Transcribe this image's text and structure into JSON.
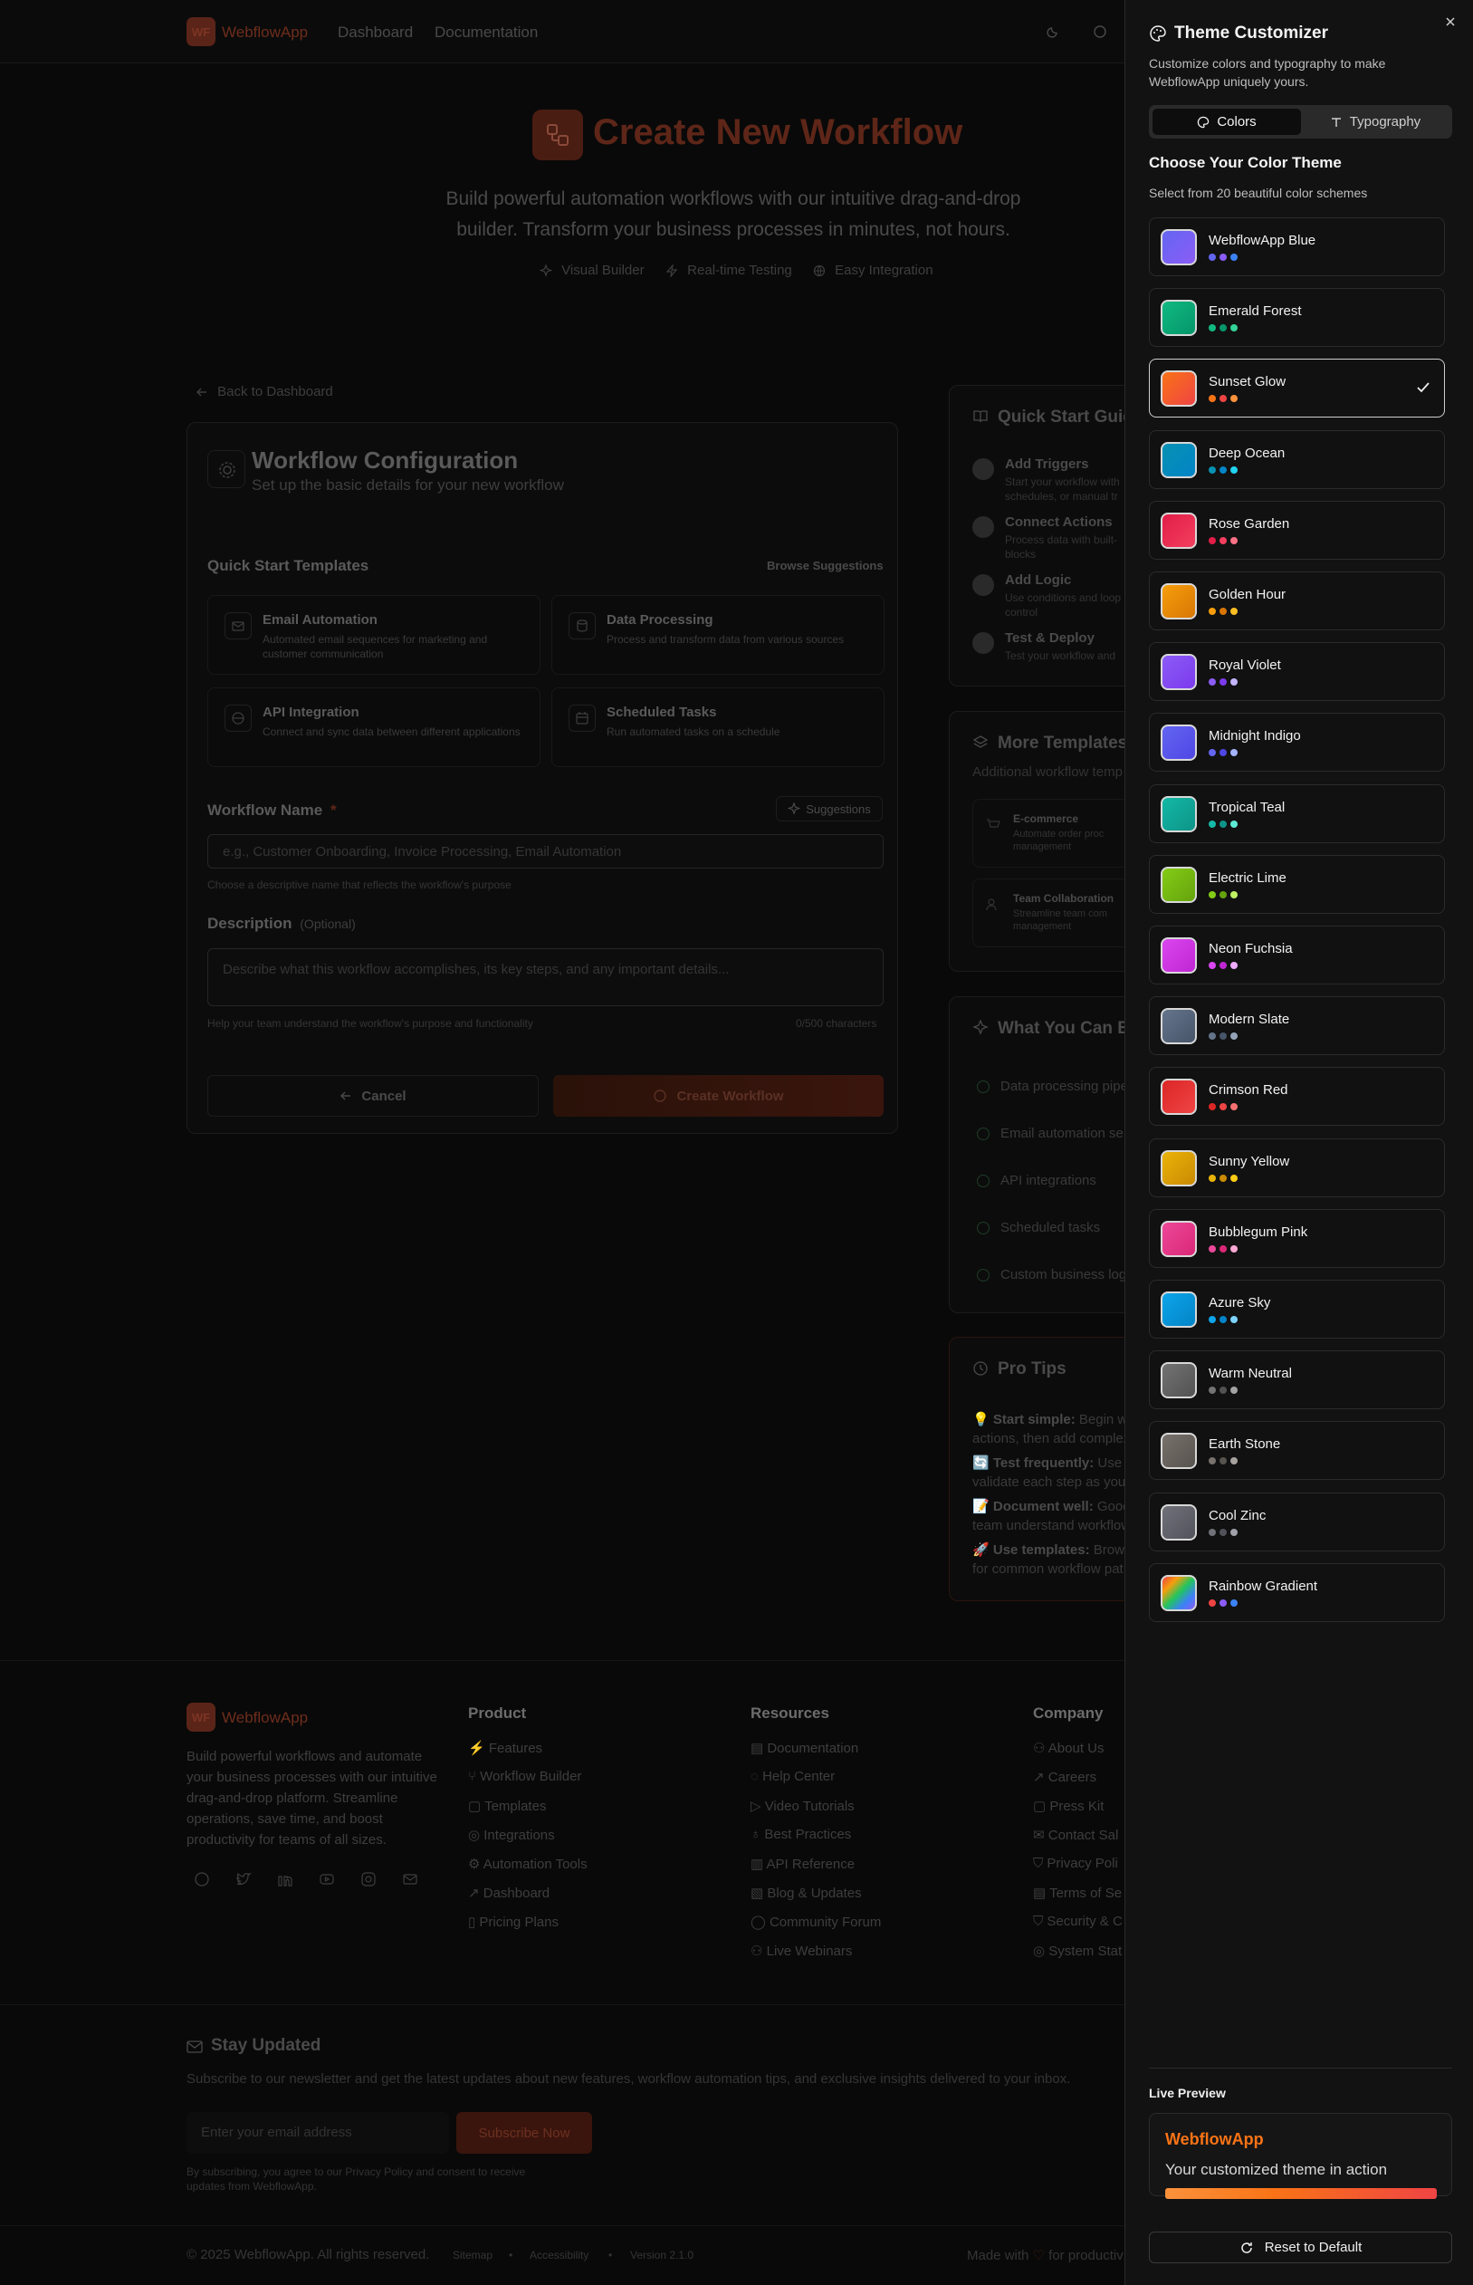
{
  "nav": {
    "logo_abbr": "WF",
    "brand": "WebflowApp",
    "links": [
      "Dashboard",
      "Documentation"
    ]
  },
  "hero": {
    "title": "Create New Workflow",
    "subtitle_line1": "Build powerful automation workflows with our intuitive drag-and-drop",
    "subtitle_line2": "builder. Transform your business processes in minutes, not hours.",
    "features": [
      "Visual Builder",
      "Real-time Testing",
      "Easy Integration"
    ]
  },
  "back_link": "Back to Dashboard",
  "config": {
    "title": "Workflow Configuration",
    "subtitle": "Set up the basic details for your new workflow",
    "templates_heading": "Quick Start Templates",
    "browse": "Browse Suggestions",
    "templates": [
      {
        "title": "Email Automation",
        "desc": "Automated email sequences for marketing and customer communication"
      },
      {
        "title": "Data Processing",
        "desc": "Process and transform data from various sources"
      },
      {
        "title": "API Integration",
        "desc": "Connect and sync data between different applications"
      },
      {
        "title": "Scheduled Tasks",
        "desc": "Run automated tasks on a schedule"
      }
    ],
    "name_label": "Workflow Name",
    "required_mark": "*",
    "suggestions": "Suggestions",
    "name_placeholder": "e.g., Customer Onboarding, Invoice Processing, Email Automation",
    "name_help": "Choose a descriptive name that reflects the workflow's purpose",
    "desc_label": "Description",
    "desc_optional": "(Optional)",
    "desc_placeholder": "Describe what this workflow accomplishes, its key steps, and any important details...",
    "desc_help": "Help your team understand the workflow's purpose and functionality",
    "char_count": "0/500 characters",
    "cancel": "Cancel",
    "create": "Create Workflow"
  },
  "quick_guide": {
    "title": "Quick Start Guid",
    "steps": [
      {
        "title": "Add Triggers",
        "desc1": "Start your workflow with",
        "desc2": "schedules, or manual tr"
      },
      {
        "title": "Connect Actions",
        "desc1": "Process data with built-",
        "desc2": "blocks"
      },
      {
        "title": "Add Logic",
        "desc1": "Use conditions and loop",
        "desc2": "control"
      },
      {
        "title": "Test & Deploy",
        "desc1": "Test your workflow and",
        "desc2": ""
      }
    ]
  },
  "more_templates": {
    "title": "More Templates",
    "subtitle": "Additional workflow temp",
    "items": [
      {
        "title": "E-commerce",
        "desc1": "Automate order proc",
        "desc2": "management"
      },
      {
        "title": "Team Collaboration",
        "desc1": "Streamline team com",
        "desc2": "management"
      }
    ]
  },
  "build": {
    "title": "What You Can Bu",
    "items": [
      "Data processing pipe",
      "Email automation se",
      "API integrations",
      "Scheduled tasks",
      "Custom business log"
    ]
  },
  "tips": {
    "title": "Pro Tips",
    "items": [
      {
        "emoji": "💡",
        "bold": "Start simple:",
        "l1": " Begin wi",
        "l2": "actions, then add complex"
      },
      {
        "emoji": "🔄",
        "bold": "Test frequently:",
        "l1": " Use t",
        "l2": "validate each step as you"
      },
      {
        "emoji": "📝",
        "bold": "Document well:",
        "l1": " Good",
        "l2": "team understand workflow"
      },
      {
        "emoji": "🚀",
        "bold": "Use templates:",
        "l1": " Brows",
        "l2": "for common workflow pat"
      }
    ]
  },
  "footer": {
    "brand": "WebflowApp",
    "logo_abbr": "WF",
    "about": [
      "Build powerful workflows and automate",
      "your business processes with our intuitive",
      "drag-and-drop platform. Streamline",
      "operations, save time, and boost",
      "productivity for teams of all sizes."
    ],
    "socials": [
      "github-icon",
      "twitter-icon",
      "linkedin-icon",
      "youtube-icon",
      "instagram-icon",
      "mail-icon"
    ],
    "columns": [
      {
        "title": "Product",
        "links": [
          "Features",
          "Workflow Builder",
          "Templates",
          "Integrations",
          "Automation Tools",
          "Dashboard",
          "Pricing Plans"
        ]
      },
      {
        "title": "Resources",
        "links": [
          "Documentation",
          "Help Center",
          "Video Tutorials",
          "Best Practices",
          "API Reference",
          "Blog & Updates",
          "Community Forum",
          "Live Webinars"
        ]
      },
      {
        "title": "Company",
        "links": [
          "About Us",
          "Careers",
          "Press Kit",
          "Contact Sal",
          "Privacy Poli",
          "Terms of Se",
          "Security & C",
          "System Stat"
        ]
      }
    ],
    "newsletter_title": "Stay Updated",
    "newsletter_desc": "Subscribe to our newsletter and get the latest updates about new features, workflow automation tips, and exclusive insights delivered to your inbox.",
    "email_placeholder": "Enter your email address",
    "subscribe": "Subscribe Now",
    "consent1": "By subscribing, you agree to our Privacy Policy and consent to receive",
    "consent2": "updates from WebflowApp.",
    "copyright": "© 2025 WebflowApp. All rights reserved.",
    "bottom_links": [
      "Sitemap",
      "Accessibility",
      "Version 2.1.0"
    ],
    "made_with": "Made with",
    "for_prod": "for productiv"
  },
  "panel": {
    "title": "Theme Customizer",
    "desc1": "Customize colors and typography to make",
    "desc2": "WebflowApp uniquely yours.",
    "tabs": [
      "Colors",
      "Typography"
    ],
    "choose_title": "Choose Your Color Theme",
    "choose_desc": "Select from 20 beautiful color schemes",
    "themes": [
      {
        "name": "WebflowApp Blue",
        "c1": "#6366f1",
        "c2": "#8b5cf6",
        "c3": "#3b82f6"
      },
      {
        "name": "Emerald Forest",
        "c1": "#10b981",
        "c2": "#059669",
        "c3": "#34d399"
      },
      {
        "name": "Sunset Glow",
        "c1": "#f97316",
        "c2": "#ef4444",
        "c3": "#fb923c"
      },
      {
        "name": "Deep Ocean",
        "c1": "#0891b2",
        "c2": "#0284c7",
        "c3": "#22d3ee"
      },
      {
        "name": "Rose Garden",
        "c1": "#e11d48",
        "c2": "#f43f5e",
        "c3": "#fb7185"
      },
      {
        "name": "Golden Hour",
        "c1": "#f59e0b",
        "c2": "#d97706",
        "c3": "#fbbf24"
      },
      {
        "name": "Royal Violet",
        "c1": "#8b5cf6",
        "c2": "#7c3aed",
        "c3": "#c4b5fd"
      },
      {
        "name": "Midnight Indigo",
        "c1": "#6366f1",
        "c2": "#4f46e5",
        "c3": "#a5b4fc"
      },
      {
        "name": "Tropical Teal",
        "c1": "#14b8a6",
        "c2": "#0d9488",
        "c3": "#5eead4"
      },
      {
        "name": "Electric Lime",
        "c1": "#84cc16",
        "c2": "#65a30d",
        "c3": "#bef264"
      },
      {
        "name": "Neon Fuchsia",
        "c1": "#d946ef",
        "c2": "#c026d3",
        "c3": "#f0abfc"
      },
      {
        "name": "Modern Slate",
        "c1": "#64748b",
        "c2": "#475569",
        "c3": "#94a3b8"
      },
      {
        "name": "Crimson Red",
        "c1": "#dc2626",
        "c2": "#ef4444",
        "c3": "#f87171"
      },
      {
        "name": "Sunny Yellow",
        "c1": "#eab308",
        "c2": "#ca8a04",
        "c3": "#facc15"
      },
      {
        "name": "Bubblegum Pink",
        "c1": "#ec4899",
        "c2": "#db2777",
        "c3": "#f9a8d4"
      },
      {
        "name": "Azure Sky",
        "c1": "#0ea5e9",
        "c2": "#0284c7",
        "c3": "#7dd3fc"
      },
      {
        "name": "Warm Neutral",
        "c1": "#737373",
        "c2": "#525252",
        "c3": "#a3a3a3"
      },
      {
        "name": "Earth Stone",
        "c1": "#78716c",
        "c2": "#57534e",
        "c3": "#a8a29e"
      },
      {
        "name": "Cool Zinc",
        "c1": "#71717a",
        "c2": "#52525b",
        "c3": "#a1a1aa"
      },
      {
        "name": "Rainbow Gradient",
        "c1": "#ef4444",
        "c2": "#8b5cf6",
        "c3": "#3b82f6"
      }
    ],
    "selected_index": 2,
    "live_preview_label": "Live Preview",
    "preview_brand": "WebflowApp",
    "preview_text": "Your customized theme in action",
    "reset": "Reset to Default",
    "accent": "#f97316"
  }
}
